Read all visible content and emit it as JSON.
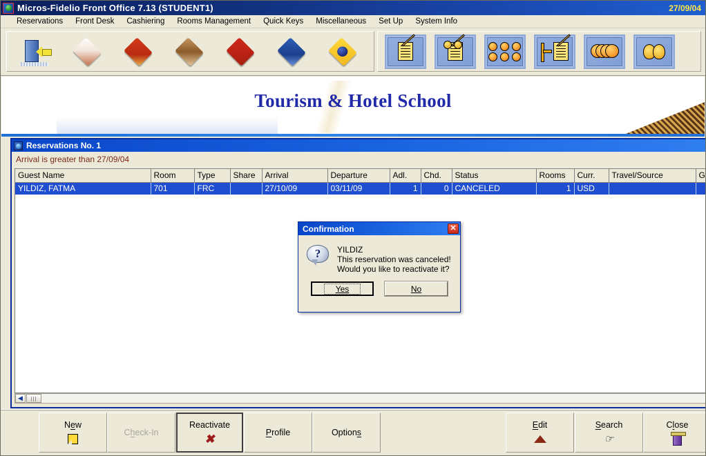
{
  "window": {
    "title": "Micros-Fidelio Front Office 7.13 (STUDENT1)",
    "date": "27/09/04",
    "app_icon": "globe-icon"
  },
  "menubar": {
    "items": [
      {
        "label": "Reservations"
      },
      {
        "label": "Front Desk"
      },
      {
        "label": "Cashiering"
      },
      {
        "label": "Rooms Management"
      },
      {
        "label": "Quick Keys"
      },
      {
        "label": "Miscellaneous"
      },
      {
        "label": "Set Up"
      },
      {
        "label": "System Info"
      }
    ]
  },
  "toolbar": {
    "left_group": [
      {
        "name": "exit-icon"
      },
      {
        "name": "reservations-icon"
      },
      {
        "name": "front-desk-icon"
      },
      {
        "name": "cashiering-icon"
      },
      {
        "name": "rooms-management-icon"
      },
      {
        "name": "quick-keys-icon"
      },
      {
        "name": "miscellaneous-icon"
      }
    ],
    "right_group": [
      {
        "name": "new-reservation-icon"
      },
      {
        "name": "edit-profile-icon"
      },
      {
        "name": "billing-icon"
      },
      {
        "name": "room-plan-icon"
      },
      {
        "name": "cashier-icon"
      },
      {
        "name": "events-icon"
      }
    ]
  },
  "banner": {
    "title": "Tourism & Hotel School",
    "decoration": "pastry-photo"
  },
  "reservations_window": {
    "title": "Reservations  No. 1",
    "filter_text": "Arrival is greater than 27/09/04",
    "columns": [
      "Guest Name",
      "Room",
      "Type",
      "Share",
      "Arrival",
      "Departure",
      "Adl.",
      "Chd.",
      "Status",
      "Rooms",
      "Curr.",
      "Travel/Source",
      "Group/C"
    ],
    "rows": [
      {
        "guest_name": "YILDIZ, FATMA",
        "room": "701",
        "type": "FRC",
        "share": "",
        "arrival": "27/10/09",
        "departure": "03/11/09",
        "adults": "1",
        "children": "0",
        "status": "CANCELED",
        "rooms": "1",
        "currency": "USD",
        "travel_source": "",
        "group": "",
        "selected": true
      }
    ],
    "scrollbar": {
      "left_arrow": "◀"
    }
  },
  "dialog": {
    "title": "Confirmation",
    "close_label": "✕",
    "icon": "question-bubble-icon",
    "lines": [
      "YILDIZ",
      "This reservation was canceled!",
      "Would you like to reactivate it?"
    ],
    "buttons": [
      {
        "label": "Yes",
        "accel": "Y",
        "focused": true
      },
      {
        "label": "No",
        "accel": "N",
        "focused": false
      }
    ]
  },
  "buttonbar": {
    "buttons": [
      {
        "label": "New",
        "accel_index": 2,
        "icon": "new-document-icon",
        "state": "normal"
      },
      {
        "label": "Check-In",
        "accel_index": 1,
        "icon": "none",
        "state": "disabled"
      },
      {
        "label": "Reactivate",
        "accel_index": -1,
        "icon": "red-x-icon",
        "state": "default"
      },
      {
        "label": "Profile",
        "accel_index": 0,
        "icon": "none",
        "state": "normal"
      },
      {
        "label": "Options",
        "accel_index": 5,
        "icon": "none",
        "state": "normal"
      },
      {
        "label": "Edit",
        "accel_index": 0,
        "icon": "sunrise-icon",
        "state": "normal"
      },
      {
        "label": "Search",
        "accel_index": 0,
        "icon": "pointing-hand-icon",
        "state": "normal"
      },
      {
        "label": "Close",
        "accel_index": 1,
        "icon": "exit-door-icon",
        "state": "normal"
      }
    ]
  },
  "colors": {
    "titlebar_start": "#0a1f5c",
    "titlebar_end": "#1f5fd0",
    "title_date": "#ffe94a",
    "face": "#ece9d8",
    "selection": "#1f4fd0",
    "filter_text": "#7b2a18",
    "banner_title": "#2029a8",
    "accent_x": "#9e1b1b"
  }
}
